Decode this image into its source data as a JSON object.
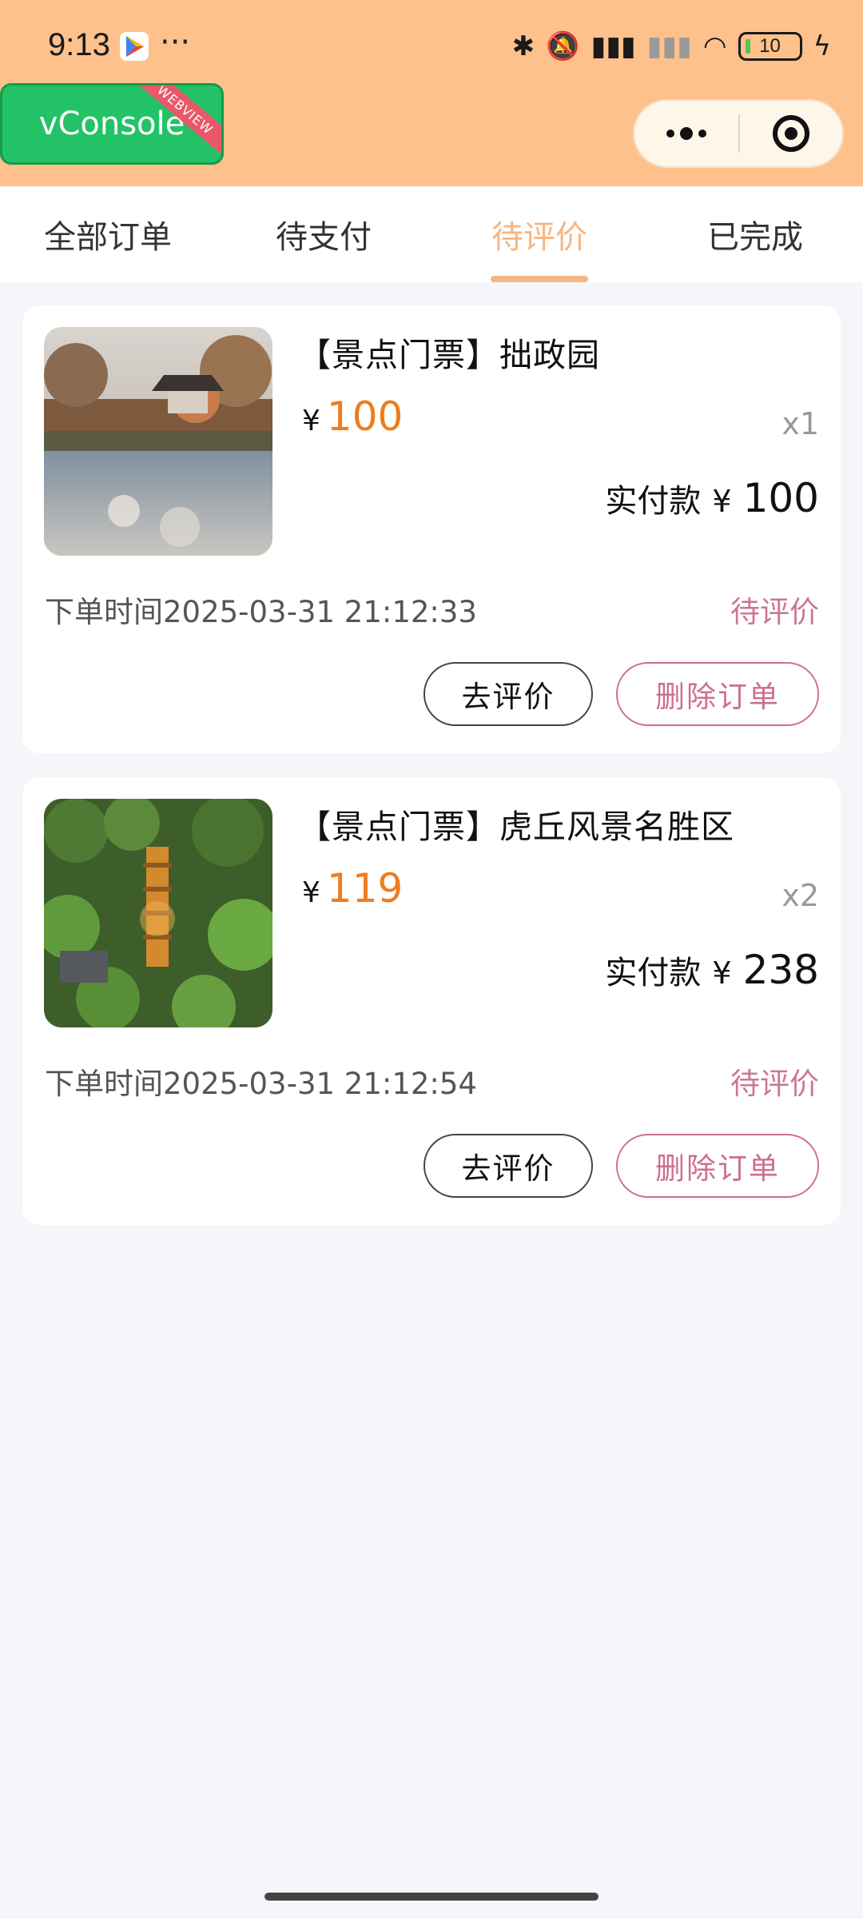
{
  "status_bar": {
    "time": "9:13",
    "extra": "···",
    "battery": "10"
  },
  "vconsole": {
    "label": "vConsole",
    "ribbon": "WEBVIEW"
  },
  "capsule": {
    "more_icon": "more-dots-icon",
    "close_icon": "target-icon"
  },
  "tabs": [
    {
      "label": "全部订单",
      "active": false
    },
    {
      "label": "待支付",
      "active": false
    },
    {
      "label": "待评价",
      "active": true
    },
    {
      "label": "已完成",
      "active": false
    }
  ],
  "orders": [
    {
      "title": "【景点门票】拙政园",
      "currency": "¥",
      "price": "100",
      "quantity": "x1",
      "paid_label": "实付款",
      "paid_amount": "100",
      "order_time": "下单时间2025-03-31 21:12:33",
      "status": "待评价",
      "review_button": "去评价",
      "delete_button": "删除订单"
    },
    {
      "title": "【景点门票】虎丘风景名胜区",
      "currency": "¥",
      "price": "119",
      "quantity": "x2",
      "paid_label": "实付款",
      "paid_amount": "238",
      "order_time": "下单时间2025-03-31 21:12:54",
      "status": "待评价",
      "review_button": "去评价",
      "delete_button": "删除订单"
    }
  ],
  "colors": {
    "header_bg": "#ffc18c",
    "active_tab": "#f6b683",
    "price": "#f07c1c",
    "status": "#cc7794"
  }
}
